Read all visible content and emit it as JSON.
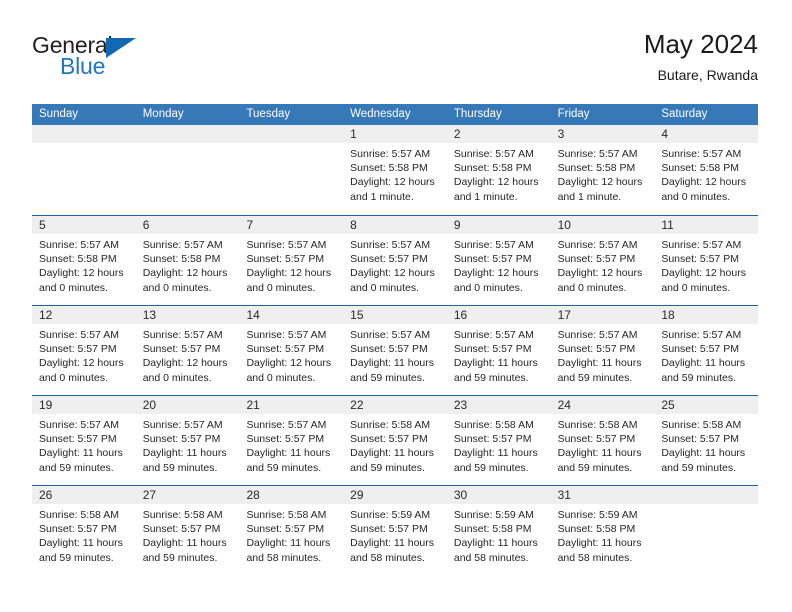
{
  "logo": {
    "word_top": "General",
    "word_bottom": "Blue",
    "triangle_color": "#1268b3"
  },
  "header": {
    "title": "May 2024",
    "subtitle": "Butare, Rwanda"
  },
  "theme": {
    "header_blue": "#3778b9",
    "divider_blue": "#1c63a8",
    "day_band_gray": "#efefef",
    "text": "#262626"
  },
  "weekdays": [
    "Sunday",
    "Monday",
    "Tuesday",
    "Wednesday",
    "Thursday",
    "Friday",
    "Saturday"
  ],
  "weeks": [
    [
      {
        "day": "",
        "empty": true
      },
      {
        "day": "",
        "empty": true
      },
      {
        "day": "",
        "empty": true
      },
      {
        "day": "1",
        "sunrise": "Sunrise: 5:57 AM",
        "sunset": "Sunset: 5:58 PM",
        "daylight1": "Daylight: 12 hours",
        "daylight2": "and 1 minute."
      },
      {
        "day": "2",
        "sunrise": "Sunrise: 5:57 AM",
        "sunset": "Sunset: 5:58 PM",
        "daylight1": "Daylight: 12 hours",
        "daylight2": "and 1 minute."
      },
      {
        "day": "3",
        "sunrise": "Sunrise: 5:57 AM",
        "sunset": "Sunset: 5:58 PM",
        "daylight1": "Daylight: 12 hours",
        "daylight2": "and 1 minute."
      },
      {
        "day": "4",
        "sunrise": "Sunrise: 5:57 AM",
        "sunset": "Sunset: 5:58 PM",
        "daylight1": "Daylight: 12 hours",
        "daylight2": "and 0 minutes."
      }
    ],
    [
      {
        "day": "5",
        "sunrise": "Sunrise: 5:57 AM",
        "sunset": "Sunset: 5:58 PM",
        "daylight1": "Daylight: 12 hours",
        "daylight2": "and 0 minutes."
      },
      {
        "day": "6",
        "sunrise": "Sunrise: 5:57 AM",
        "sunset": "Sunset: 5:58 PM",
        "daylight1": "Daylight: 12 hours",
        "daylight2": "and 0 minutes."
      },
      {
        "day": "7",
        "sunrise": "Sunrise: 5:57 AM",
        "sunset": "Sunset: 5:57 PM",
        "daylight1": "Daylight: 12 hours",
        "daylight2": "and 0 minutes."
      },
      {
        "day": "8",
        "sunrise": "Sunrise: 5:57 AM",
        "sunset": "Sunset: 5:57 PM",
        "daylight1": "Daylight: 12 hours",
        "daylight2": "and 0 minutes."
      },
      {
        "day": "9",
        "sunrise": "Sunrise: 5:57 AM",
        "sunset": "Sunset: 5:57 PM",
        "daylight1": "Daylight: 12 hours",
        "daylight2": "and 0 minutes."
      },
      {
        "day": "10",
        "sunrise": "Sunrise: 5:57 AM",
        "sunset": "Sunset: 5:57 PM",
        "daylight1": "Daylight: 12 hours",
        "daylight2": "and 0 minutes."
      },
      {
        "day": "11",
        "sunrise": "Sunrise: 5:57 AM",
        "sunset": "Sunset: 5:57 PM",
        "daylight1": "Daylight: 12 hours",
        "daylight2": "and 0 minutes."
      }
    ],
    [
      {
        "day": "12",
        "sunrise": "Sunrise: 5:57 AM",
        "sunset": "Sunset: 5:57 PM",
        "daylight1": "Daylight: 12 hours",
        "daylight2": "and 0 minutes."
      },
      {
        "day": "13",
        "sunrise": "Sunrise: 5:57 AM",
        "sunset": "Sunset: 5:57 PM",
        "daylight1": "Daylight: 12 hours",
        "daylight2": "and 0 minutes."
      },
      {
        "day": "14",
        "sunrise": "Sunrise: 5:57 AM",
        "sunset": "Sunset: 5:57 PM",
        "daylight1": "Daylight: 12 hours",
        "daylight2": "and 0 minutes."
      },
      {
        "day": "15",
        "sunrise": "Sunrise: 5:57 AM",
        "sunset": "Sunset: 5:57 PM",
        "daylight1": "Daylight: 11 hours",
        "daylight2": "and 59 minutes."
      },
      {
        "day": "16",
        "sunrise": "Sunrise: 5:57 AM",
        "sunset": "Sunset: 5:57 PM",
        "daylight1": "Daylight: 11 hours",
        "daylight2": "and 59 minutes."
      },
      {
        "day": "17",
        "sunrise": "Sunrise: 5:57 AM",
        "sunset": "Sunset: 5:57 PM",
        "daylight1": "Daylight: 11 hours",
        "daylight2": "and 59 minutes."
      },
      {
        "day": "18",
        "sunrise": "Sunrise: 5:57 AM",
        "sunset": "Sunset: 5:57 PM",
        "daylight1": "Daylight: 11 hours",
        "daylight2": "and 59 minutes."
      }
    ],
    [
      {
        "day": "19",
        "sunrise": "Sunrise: 5:57 AM",
        "sunset": "Sunset: 5:57 PM",
        "daylight1": "Daylight: 11 hours",
        "daylight2": "and 59 minutes."
      },
      {
        "day": "20",
        "sunrise": "Sunrise: 5:57 AM",
        "sunset": "Sunset: 5:57 PM",
        "daylight1": "Daylight: 11 hours",
        "daylight2": "and 59 minutes."
      },
      {
        "day": "21",
        "sunrise": "Sunrise: 5:57 AM",
        "sunset": "Sunset: 5:57 PM",
        "daylight1": "Daylight: 11 hours",
        "daylight2": "and 59 minutes."
      },
      {
        "day": "22",
        "sunrise": "Sunrise: 5:58 AM",
        "sunset": "Sunset: 5:57 PM",
        "daylight1": "Daylight: 11 hours",
        "daylight2": "and 59 minutes."
      },
      {
        "day": "23",
        "sunrise": "Sunrise: 5:58 AM",
        "sunset": "Sunset: 5:57 PM",
        "daylight1": "Daylight: 11 hours",
        "daylight2": "and 59 minutes."
      },
      {
        "day": "24",
        "sunrise": "Sunrise: 5:58 AM",
        "sunset": "Sunset: 5:57 PM",
        "daylight1": "Daylight: 11 hours",
        "daylight2": "and 59 minutes."
      },
      {
        "day": "25",
        "sunrise": "Sunrise: 5:58 AM",
        "sunset": "Sunset: 5:57 PM",
        "daylight1": "Daylight: 11 hours",
        "daylight2": "and 59 minutes."
      }
    ],
    [
      {
        "day": "26",
        "sunrise": "Sunrise: 5:58 AM",
        "sunset": "Sunset: 5:57 PM",
        "daylight1": "Daylight: 11 hours",
        "daylight2": "and 59 minutes."
      },
      {
        "day": "27",
        "sunrise": "Sunrise: 5:58 AM",
        "sunset": "Sunset: 5:57 PM",
        "daylight1": "Daylight: 11 hours",
        "daylight2": "and 59 minutes."
      },
      {
        "day": "28",
        "sunrise": "Sunrise: 5:58 AM",
        "sunset": "Sunset: 5:57 PM",
        "daylight1": "Daylight: 11 hours",
        "daylight2": "and 58 minutes."
      },
      {
        "day": "29",
        "sunrise": "Sunrise: 5:59 AM",
        "sunset": "Sunset: 5:57 PM",
        "daylight1": "Daylight: 11 hours",
        "daylight2": "and 58 minutes."
      },
      {
        "day": "30",
        "sunrise": "Sunrise: 5:59 AM",
        "sunset": "Sunset: 5:58 PM",
        "daylight1": "Daylight: 11 hours",
        "daylight2": "and 58 minutes."
      },
      {
        "day": "31",
        "sunrise": "Sunrise: 5:59 AM",
        "sunset": "Sunset: 5:58 PM",
        "daylight1": "Daylight: 11 hours",
        "daylight2": "and 58 minutes."
      },
      {
        "day": "",
        "empty": true
      }
    ]
  ]
}
